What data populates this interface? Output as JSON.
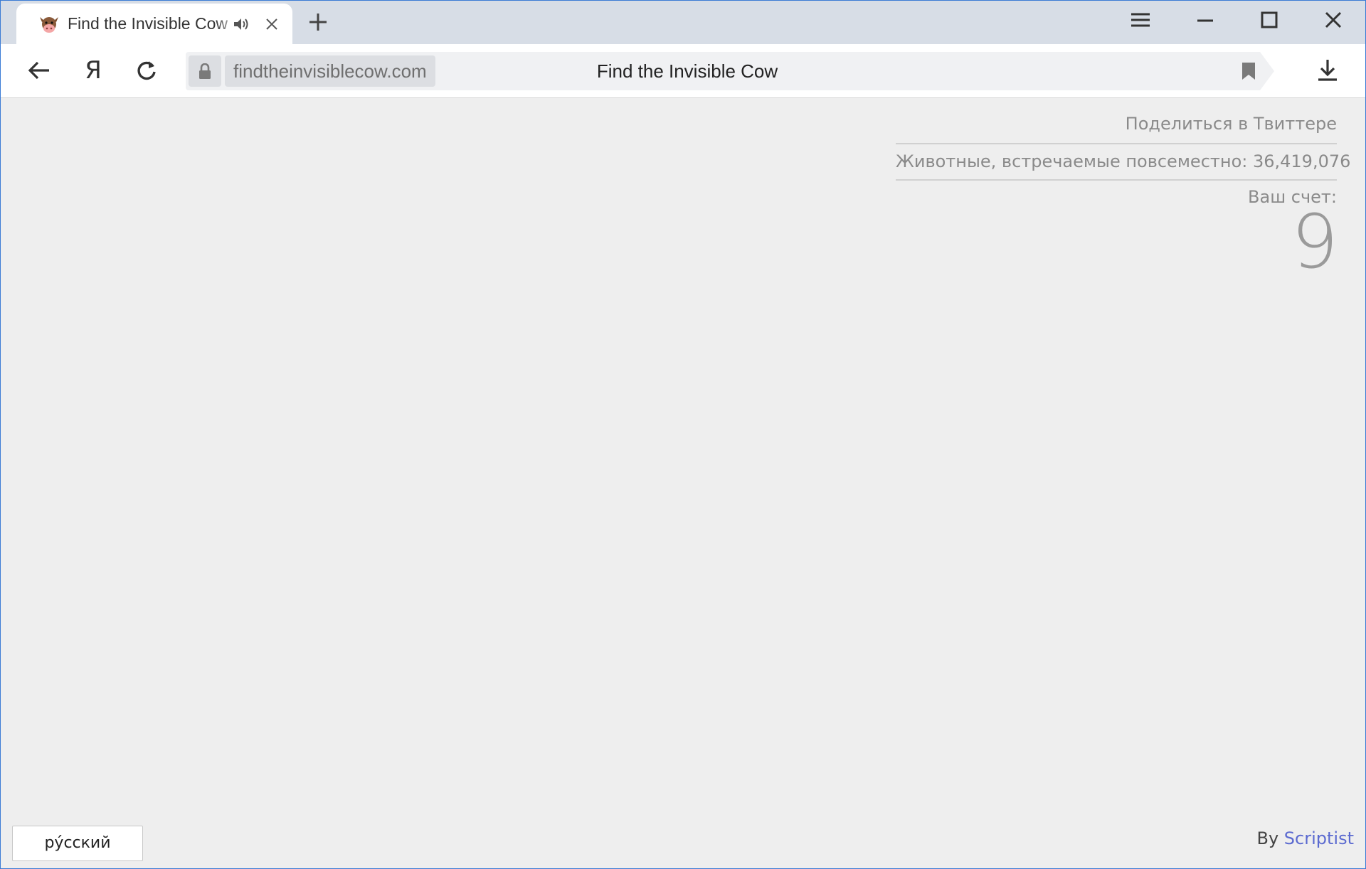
{
  "browser": {
    "tab": {
      "title": "Find the Invisible Cow",
      "favicon": "cow-face-icon",
      "audio_icon": "speaker-icon",
      "close_icon": "close-icon"
    },
    "new_tab_icon": "plus-icon",
    "window_controls": [
      "menu-icon",
      "minimize-icon",
      "maximize-icon",
      "close-icon"
    ],
    "toolbar": {
      "back_icon": "arrow-left-icon",
      "yandex_logo": "Я",
      "reload_icon": "reload-icon",
      "download_icon": "download-icon"
    },
    "address_bar": {
      "lock_icon": "lock-icon",
      "domain": "findtheinvisiblecow.com",
      "page_title": "Find the Invisible Cow",
      "bookmark_icon": "bookmark-icon"
    }
  },
  "page": {
    "share_link": "Поделиться в Твиттере",
    "animals_found": "Животные, встречаемые повсеместно: 36,419,076",
    "score_label": "Ваш счет:",
    "score_value": "9",
    "language_button": "ру́сский",
    "byline_prefix": "By",
    "byline_author": "Scriptist"
  },
  "colors": {
    "page_background": "#eeeeee",
    "tab_strip": "#d7dde6",
    "link_accent": "#5b6ad0",
    "muted_text": "#8a8a8a"
  }
}
